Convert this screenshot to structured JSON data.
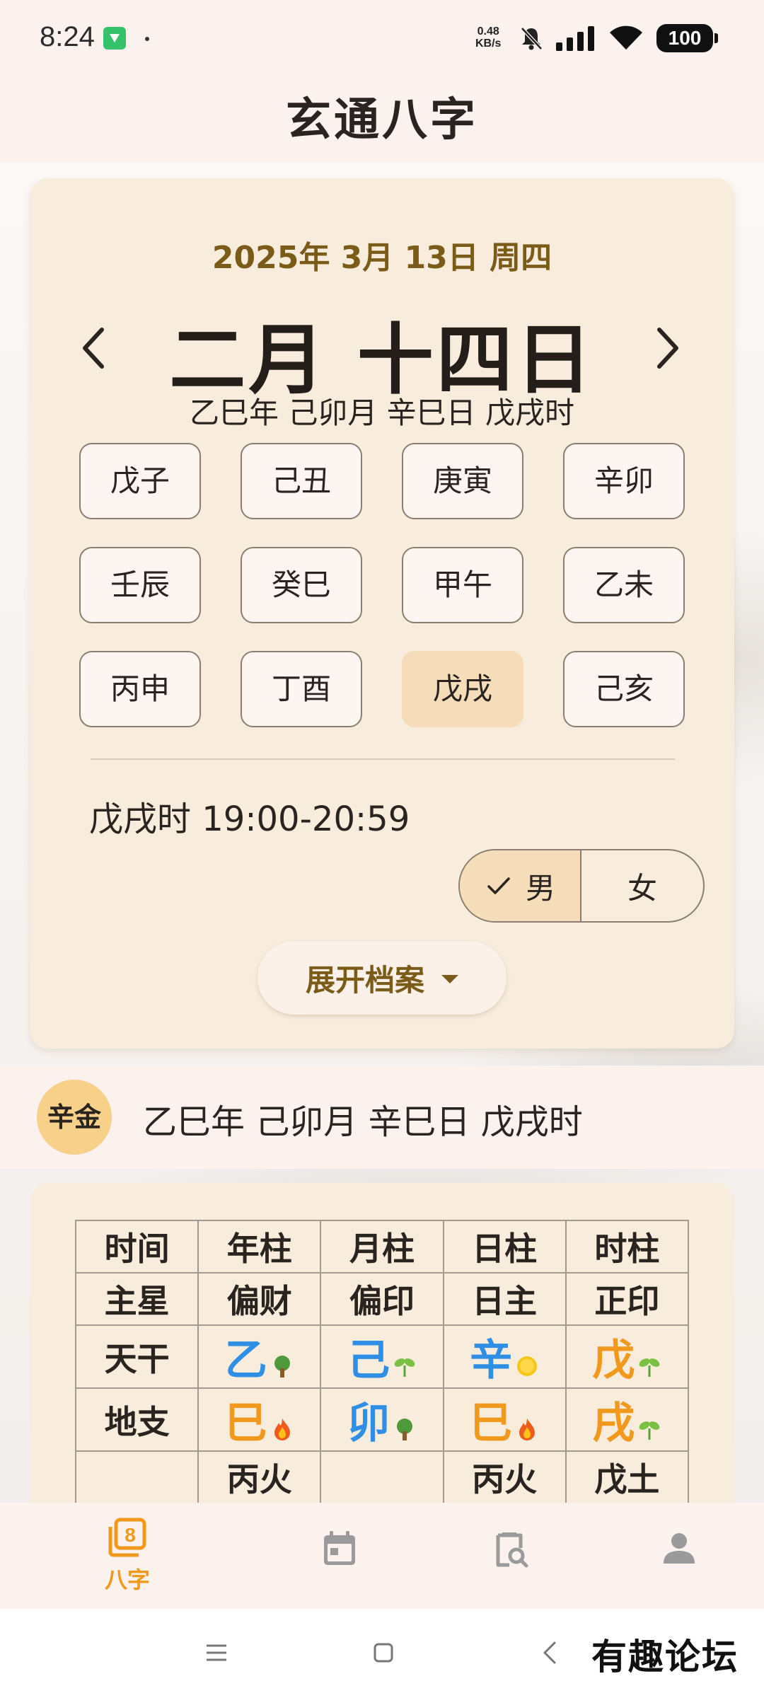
{
  "status_bar": {
    "time": "8:24",
    "net_speed_value": "0.48",
    "net_speed_unit": "KB/s",
    "battery": "100",
    "icons": [
      "app-notification-icon",
      "bell-muted-icon",
      "signal-icon",
      "wifi-icon",
      "battery-icon"
    ]
  },
  "header": {
    "title": "玄通八字"
  },
  "date_card": {
    "solar_date": "2025年 3月 13日 周四",
    "lunar_date": "二月 十四日",
    "ganzhi": "乙巳年 己卯月 辛巳日 戊戌时",
    "hours": [
      "戊子",
      "己丑",
      "庚寅",
      "辛卯",
      "壬辰",
      "癸巳",
      "甲午",
      "乙未",
      "丙申",
      "丁酉",
      "戊戌",
      "己亥"
    ],
    "selected_hour": "戊戌",
    "hour_range": "戊戌时 19:00-20:59",
    "gender": {
      "male": "男",
      "female": "女",
      "selected": "男"
    },
    "expand_label": "展开档案"
  },
  "summary": {
    "element": "辛金",
    "ganzhi": "乙巳年 己卯月 辛巳日 戊戌时"
  },
  "bazi_table": {
    "header": [
      "时间",
      "年柱",
      "月柱",
      "日柱",
      "时柱"
    ],
    "main_star": [
      "主星",
      "偏财",
      "偏印",
      "日主",
      "正印"
    ],
    "tiangan_label": "天干",
    "tiangan": [
      {
        "char": "乙",
        "color": "#2f8fe4",
        "icon": "tree-icon"
      },
      {
        "char": "己",
        "color": "#2f8fe4",
        "icon": "seedling-icon"
      },
      {
        "char": "辛",
        "color": "#2f8fe4",
        "icon": "sun-coin-icon"
      },
      {
        "char": "戊",
        "color": "#f0991d",
        "icon": "seedling-icon"
      }
    ],
    "dizhi_label": "地支",
    "dizhi": [
      {
        "char": "巳",
        "color": "#f0991d",
        "icon": "fire-icon"
      },
      {
        "char": "卯",
        "color": "#2f8fe4",
        "icon": "tree-icon"
      },
      {
        "char": "巳",
        "color": "#f0991d",
        "icon": "fire-icon"
      },
      {
        "char": "戌",
        "color": "#f0991d",
        "icon": "seedling-icon"
      }
    ],
    "hidden_stems": [
      "丙火",
      "",
      "丙火",
      "戊土"
    ]
  },
  "bottom_nav": {
    "items": [
      {
        "label": "八字",
        "icon": "bazi-8-icon",
        "active": true
      },
      {
        "label": "",
        "icon": "calendar-icon",
        "active": false
      },
      {
        "label": "",
        "icon": "clipboard-search-icon",
        "active": false
      },
      {
        "label": "",
        "icon": "person-icon",
        "active": false
      }
    ],
    "active_color": "#f0991d",
    "inactive_color": "#9a9a9a"
  },
  "watermark": "有趣论坛"
}
